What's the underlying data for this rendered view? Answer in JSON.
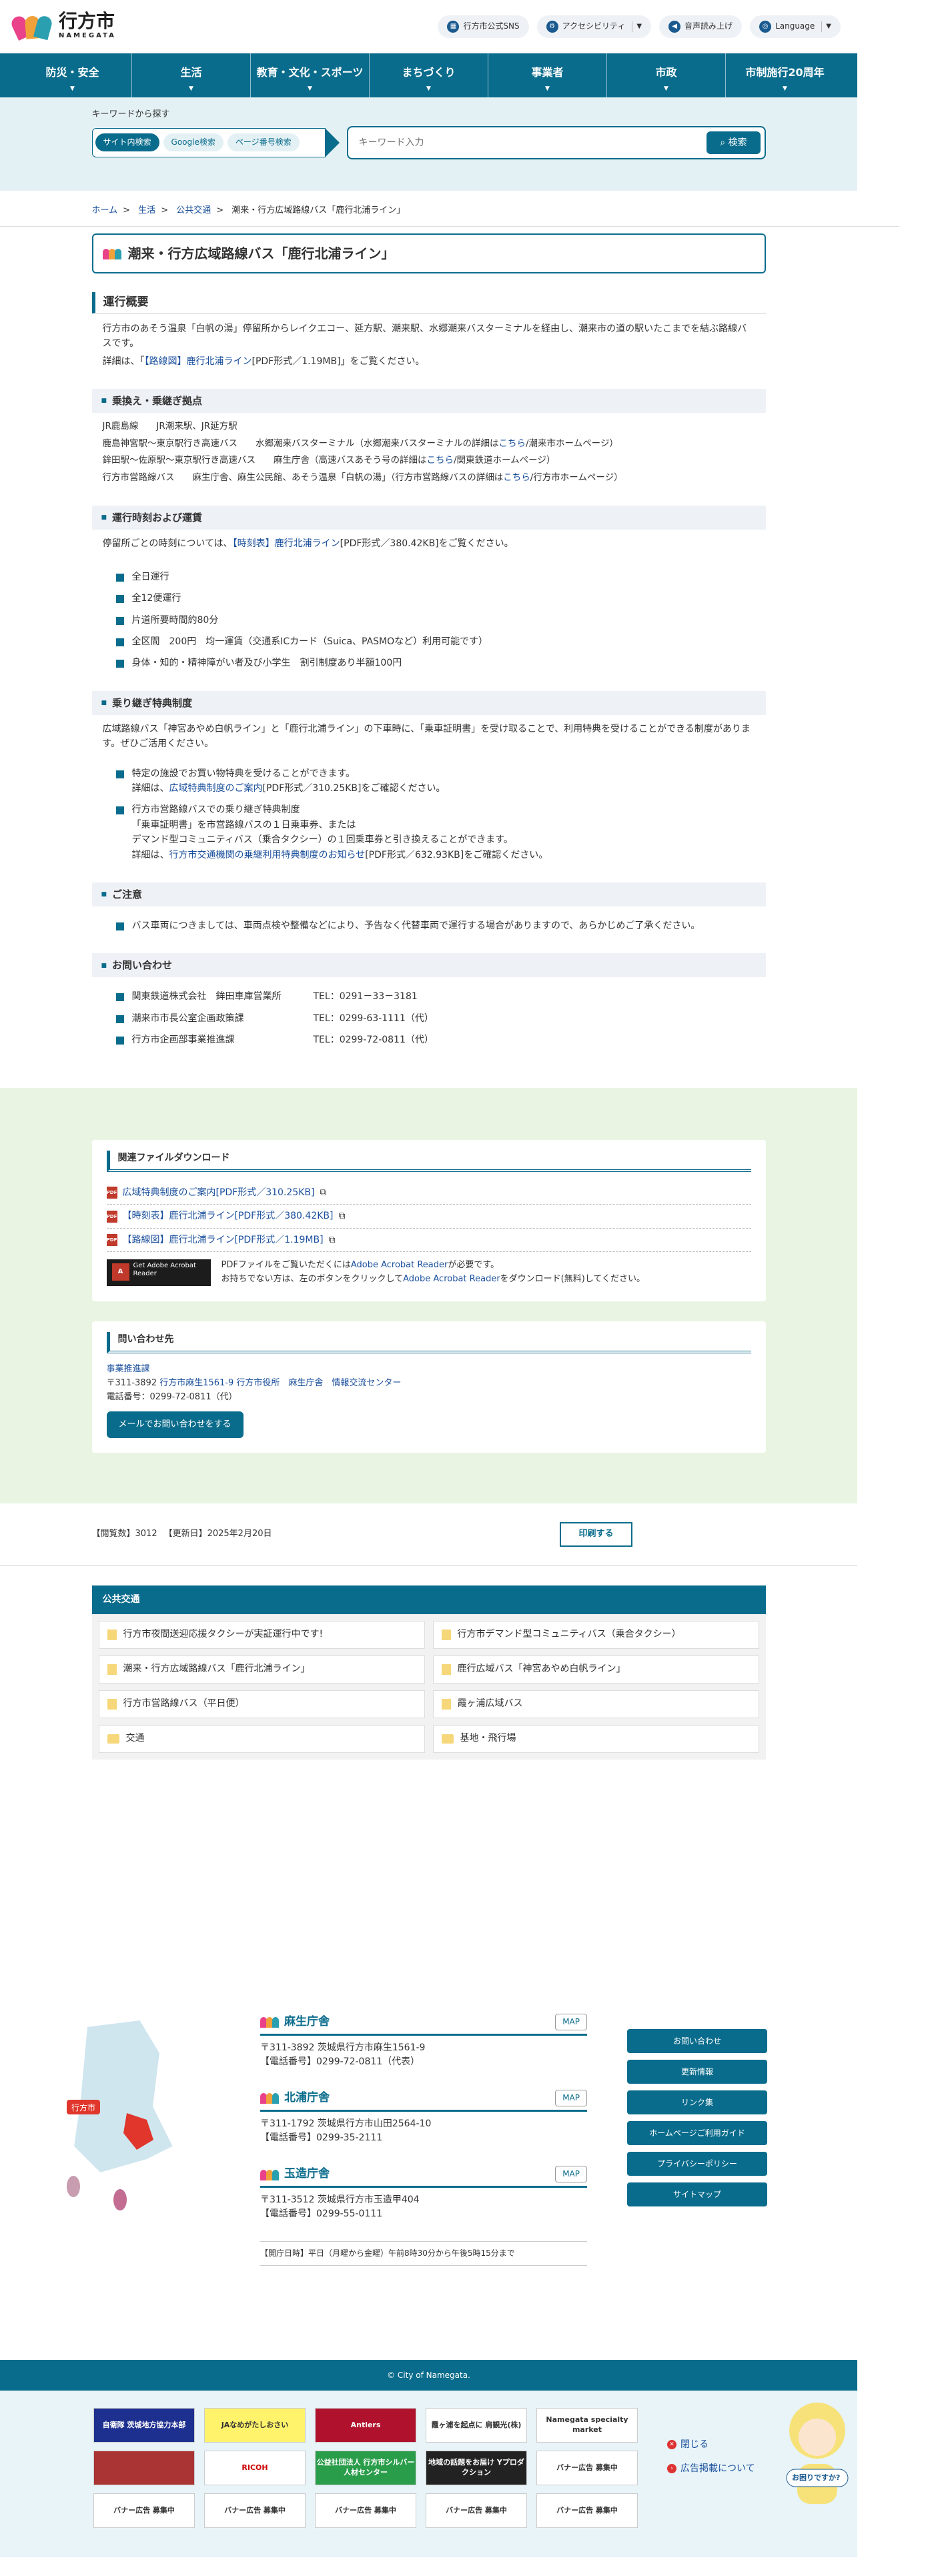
{
  "header": {
    "logo_big": "行方市",
    "logo_small": "NAMEGATA",
    "sns": "行方市公式SNS",
    "accessibility": "アクセシビリティ",
    "voice": "音声読み上げ",
    "language": "Language"
  },
  "nav": [
    "防災・安全",
    "生活",
    "教育・文化・スポーツ",
    "まちづくり",
    "事業者",
    "市政",
    "市制施行20周年"
  ],
  "search": {
    "title": "キーワードから探す",
    "tabs": [
      "サイト内検索",
      "Google検索",
      "ページ番号検索"
    ],
    "placeholder": "キーワード入力",
    "button": "検索"
  },
  "breadcrumb": [
    "ホーム",
    "生活",
    "公共交通",
    "潮来・行方広域路線バス「鹿行北浦ライン」"
  ],
  "page_title": "潮来・行方広域路線バス「鹿行北浦ライン」",
  "s1": {
    "h": "運行概要",
    "p1": "行方市のあそう温泉「白帆の湯」停留所からレイクエコー、延方駅、潮来駅、水郷潮来バスターミナルを経由し、潮来市の道の駅いたこまでを結ぶ路線バスです。",
    "p2a": "詳細は、「",
    "p2link": "【路線図】鹿行北浦ライン",
    "p2b": "[PDF形式／1.19MB]」をご覧ください。"
  },
  "s2": {
    "h": "乗換え・乗継ぎ拠点",
    "l1": "JR鹿島線　　JR潮来駅、JR延方駅",
    "l2a": "鹿島神宮駅～東京駅行き高速バス　　水郷潮来バスターミナル（水郷潮来バスターミナルの詳細は",
    "l2link": "こちら",
    "l2b": "/潮来市ホームページ）",
    "l3a": "鉾田駅～佐原駅～東京駅行き高速バス　　麻生庁舎（高速バスあそう号の詳細は",
    "l3link": "こちら",
    "l3b": "/関東鉄道ホームページ）",
    "l4a": "行方市営路線バス　　麻生庁舎、麻生公民館、あそう温泉「白帆の湯」（行方市営路線バスの詳細は",
    "l4link": "こちら",
    "l4b": "/行方市ホームページ）"
  },
  "s3": {
    "h": "運行時刻および運賃",
    "pa": "停留所ごとの時刻については、",
    "plink": "【時刻表】鹿行北浦ライン",
    "pb": "[PDF形式／380.42KB]をご覧ください。",
    "items": [
      "全日運行",
      "全12便運行",
      "片道所要時間約80分",
      "全区間　200円　均一運賃（交通系ICカード（Suica、PASMOなど）利用可能です）",
      "身体・知的・精神障がい者及び小学生　割引制度あり半額100円"
    ]
  },
  "s4": {
    "h": "乗り継ぎ特典制度",
    "p": "広域路線バス「神宮あやめ白帆ライン」と「鹿行北浦ライン」の下車時に、「乗車証明書」を受け取ることで、利用特典を受けることができる制度があります。ぜひご活用ください。",
    "i1a": "特定の施設でお買い物特典を受けることができます。",
    "i1b": "詳細は、",
    "i1link": "広域特典制度のご案内",
    "i1c": "[PDF形式／310.25KB]をご確認ください。",
    "i2a": "行方市営路線バスでの乗り継ぎ特典制度",
    "i2b": "「乗車証明書」を市営路線バスの１日乗車券、または",
    "i2c": "デマンド型コミュニティバス（乗合タクシー）の１回乗車券と引き換えることができます。",
    "i2d": "詳細は、",
    "i2link": "行方市交通機関の乗継利用特典制度のお知らせ",
    "i2e": "[PDF形式／632.93KB]をご確認ください。"
  },
  "s5": {
    "h": "ご注意",
    "item": "バス車両につきましては、車両点検や整備などにより、予告なく代替車両で運行する場合がありますので、あらかじめご了承ください。"
  },
  "s6": {
    "h": "お問い合わせ",
    "rows": [
      {
        "org": "関東鉄道株式会社　鉾田車庫営業所",
        "tel": "TEL：0291－33－3181"
      },
      {
        "org": "潮来市市長公室企画政策課",
        "tel": "TEL：0299-63-1111（代）"
      },
      {
        "org": "行方市企画部事業推進課",
        "tel": "TEL：0299-72-0811（代）"
      }
    ]
  },
  "downloads": {
    "h": "関連ファイルダウンロード",
    "files": [
      "広域特典制度のご案内[PDF形式／310.25KB]",
      "【時刻表】鹿行北浦ライン[PDF形式／380.42KB]",
      "【路線図】鹿行北浦ライン[PDF形式／1.19MB]"
    ],
    "acro_img": "Get Adobe Acrobat Reader",
    "acro1a": "PDFファイルをご覧いただくには",
    "acro1link": "Adobe Acrobat Reader",
    "acro1b": "が必要です。",
    "acro2a": "お持ちでない方は、左のボタンをクリックして",
    "acro2link": "Adobe Acrobat Reader",
    "acro2b": "をダウンロード(無料)してください。"
  },
  "contact": {
    "h": "問い合わせ先",
    "dept": "事業推進課",
    "addr_a": "〒311-3892 ",
    "addr_link": "行方市麻生1561-9 行方市役所　麻生庁舎　情報交流センター",
    "tel": "電話番号：0299-72-0811（代）",
    "mail": "メールでお問い合わせをする"
  },
  "counter": {
    "views": "【閲覧数】3012",
    "updated": "【更新日】2025年2月20日",
    "print": "印刷する"
  },
  "related": {
    "h": "公共交通",
    "items": [
      "行方市夜間送迎応援タクシーが実証運行中です!",
      "行方市デマンド型コミュニティバス（乗合タクシー）",
      "潮来・行方広域路線バス「鹿行北浦ライン」",
      "鹿行広域バス「神宮あやめ白帆ライン」",
      "行方市営路線バス（平日便）",
      "霞ヶ浦広域バス",
      "交通",
      "基地・飛行場"
    ]
  },
  "footer": {
    "map_label": "行方市",
    "offices": [
      {
        "name": "麻生庁舎",
        "addr": "〒311-3892 茨城県行方市麻生1561-9",
        "tel": "【電話番号】0299-72-0811（代表）"
      },
      {
        "name": "北浦庁舎",
        "addr": "〒311-1792 茨城県行方市山田2564-10",
        "tel": "【電話番号】0299-35-2111"
      },
      {
        "name": "玉造庁舎",
        "addr": "〒311-3512 茨城県行方市玉造甲404",
        "tel": "【電話番号】0299-55-0111"
      }
    ],
    "map_btn": "MAP",
    "hours": "【開庁日時】平日（月曜から金曜）午前8時30分から午後5時15分まで",
    "nav": [
      "お問い合わせ",
      "更新情報",
      "リンク集",
      "ホームページご利用ガイド",
      "プライバシーポリシー",
      "サイトマップ"
    ],
    "copy": "© City of Namegata."
  },
  "banners": [
    "自衛隊 茨城地方協力本部",
    "JAなめがたしおさい",
    "Antlers",
    "霞ヶ浦を起点に 肩観光(株)",
    "Namegata specialty market",
    "",
    "RICOH",
    "公益社団法人 行方市シルバー人材センター",
    "地域の話題をお届け Yプロダクション",
    "バナー広告 募集中",
    "バナー広告 募集中",
    "バナー広告 募集中",
    "バナー広告 募集中",
    "バナー広告 募集中",
    "バナー広告 募集中"
  ],
  "side": {
    "close": "閉じる",
    "ad": "広告掲載について",
    "bubble": "お困りですか?"
  }
}
